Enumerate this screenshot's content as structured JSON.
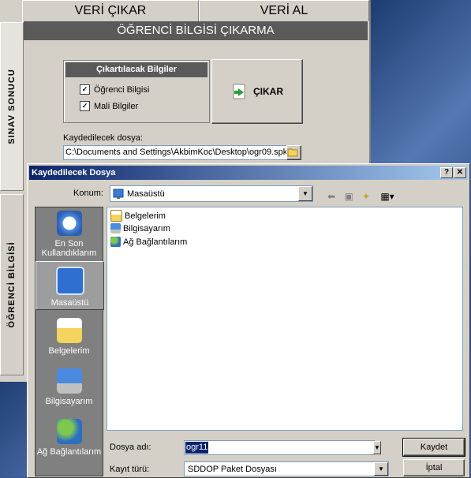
{
  "app": {
    "tabs": [
      "VERİ ÇIKAR",
      "VERİ AL"
    ],
    "side_tabs": [
      "SINAV SONUCU",
      "ÖĞRENCİ BİLGİSİ"
    ],
    "header": "ÖĞRENCİ BİLGİSİ ÇIKARMA",
    "group_title": "Çıkartılacak Bilgiler",
    "checkboxes": [
      {
        "label": "Öğrenci Bilgisi",
        "checked": true
      },
      {
        "label": "Mali Bilgiler",
        "checked": true
      }
    ],
    "cikar_label": "ÇIKAR",
    "file_label": "Kaydedilecek dosya:",
    "file_path": "C:\\Documents and Settings\\AkbimKoc\\Desktop\\ogr09.spk"
  },
  "dialog": {
    "title": "Kaydedilecek Dosya",
    "help": "?",
    "close": "✕",
    "konum_label": "Konum:",
    "konum_value": "Masaüstü",
    "places": [
      "En Son Kullandıklarım",
      "Masaüstü",
      "Belgelerim",
      "Bilgisayarım",
      "Ağ Bağlantılarım"
    ],
    "files": [
      "Belgelerim",
      "Bilgisayarım",
      "Ağ Bağlantılarım"
    ],
    "filename_label": "Dosya adı:",
    "filename_value": "ogr11",
    "filetype_label": "Kayıt türü:",
    "filetype_value": "SDDOP Paket Dosyası",
    "save_label": "Kaydet",
    "cancel_label": "İptal"
  }
}
